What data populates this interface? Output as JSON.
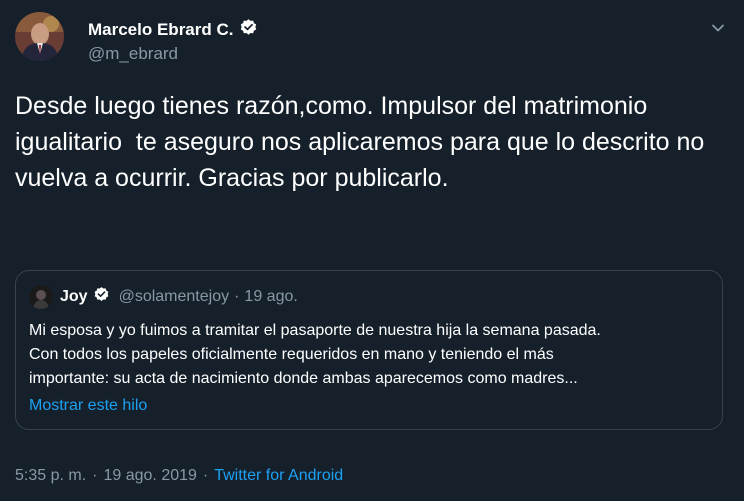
{
  "author": {
    "name": "Marcelo Ebrard C.",
    "handle": "@m_ebrard",
    "verified_icon": "verified-badge-icon"
  },
  "tweet": {
    "text": "Desde luego tienes razón,como. Impulsor del matrimonio igualitario  te aseguro nos aplicaremos para que lo descrito no vuelva a ocurrir. Gracias por publicarlo."
  },
  "quoted": {
    "name": "Joy",
    "handle": "@solamentejoy",
    "separator": "·",
    "date": "19 ago.",
    "lines": [
      "Mi esposa y yo fuimos a tramitar el pasaporte de nuestra hija la semana pasada.",
      "Con todos los papeles oficialmente requeridos en mano y teniendo el más",
      "importante: su acta de nacimiento donde ambas aparecemos como madres..."
    ],
    "thread_link": "Mostrar este hilo"
  },
  "meta": {
    "time": "5:35 p. m.",
    "separator": "·",
    "date": "19 ago. 2019",
    "separator2": "·",
    "source": "Twitter for Android"
  },
  "colors": {
    "background": "#15202b",
    "text": "#ffffff",
    "muted": "#8899a6",
    "accent": "#1da1f2",
    "border": "#38444d"
  }
}
